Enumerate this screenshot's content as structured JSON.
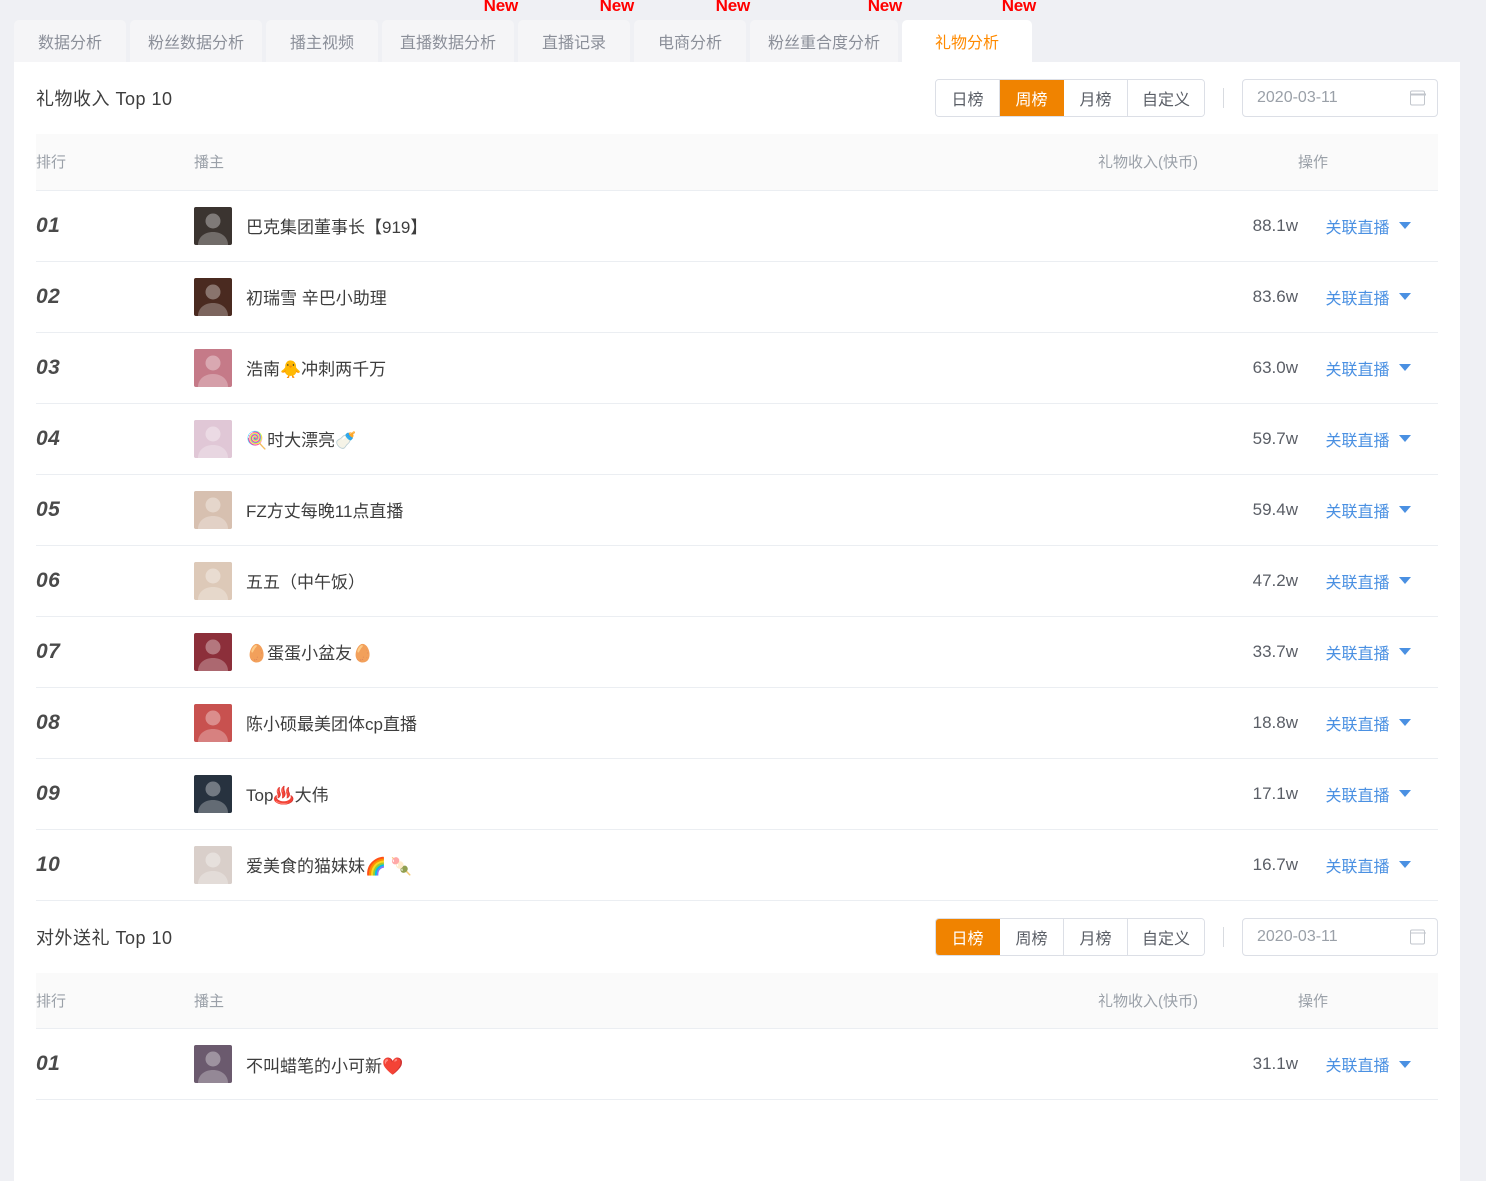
{
  "tabs": [
    {
      "label": "数据分析",
      "new": false,
      "active": false
    },
    {
      "label": "粉丝数据分析",
      "new": false,
      "active": false
    },
    {
      "label": "播主视频",
      "new": false,
      "active": false
    },
    {
      "label": "直播数据分析",
      "new": true,
      "active": false
    },
    {
      "label": "直播记录",
      "new": true,
      "active": false
    },
    {
      "label": "电商分析",
      "new": true,
      "active": false
    },
    {
      "label": "粉丝重合度分析",
      "new": true,
      "active": false
    },
    {
      "label": "礼物分析",
      "new": true,
      "active": true
    }
  ],
  "badge_text": "New",
  "colors": {
    "accent": "#f08300",
    "active_tab_text": "#ff8a00",
    "link": "#4a90e2",
    "badge": "#ff0000",
    "page_bg": "#eff0f4"
  },
  "columns": {
    "rank": "排行",
    "host": "播主",
    "value": "礼物收入(快币)",
    "action": "操作"
  },
  "action_label": "关联直播",
  "sections": [
    {
      "title": "礼物收入 Top 10",
      "range_buttons": [
        {
          "label": "日榜",
          "active": false
        },
        {
          "label": "周榜",
          "active": true
        },
        {
          "label": "月榜",
          "active": false
        },
        {
          "label": "自定义",
          "active": false
        }
      ],
      "date": "2020-03-11",
      "rows": [
        {
          "rank": "01",
          "name": "巴克集团董事长【919】",
          "value": "88.1w",
          "avatar": "#3b3430"
        },
        {
          "rank": "02",
          "name": "初瑞雪 辛巴小助理",
          "value": "83.6w",
          "avatar": "#4a2a20"
        },
        {
          "rank": "03",
          "name": "浩南🐥冲刺两千万",
          "value": "63.0w",
          "avatar": "#c57a88"
        },
        {
          "rank": "04",
          "name": "🍭时大漂亮🍼",
          "value": "59.7w",
          "avatar": "#e0c7d6"
        },
        {
          "rank": "05",
          "name": "FZ方丈每晚11点直播",
          "value": "59.4w",
          "avatar": "#d7c0b0"
        },
        {
          "rank": "06",
          "name": "五五（中午饭）",
          "value": "47.2w",
          "avatar": "#ddc9b8"
        },
        {
          "rank": "07",
          "name": "🥚蛋蛋小盆友🥚",
          "value": "33.7w",
          "avatar": "#8c2f3a"
        },
        {
          "rank": "08",
          "name": "陈小硕最美团体cp直播",
          "value": "18.8w",
          "avatar": "#c8514f"
        },
        {
          "rank": "09",
          "name": "Top♨️大伟",
          "value": "17.1w",
          "avatar": "#27323f"
        },
        {
          "rank": "10",
          "name": "爱美食的猫妹妹🌈 🍡",
          "value": "16.7w",
          "avatar": "#d9cfca"
        }
      ]
    },
    {
      "title": "对外送礼 Top 10",
      "range_buttons": [
        {
          "label": "日榜",
          "active": true
        },
        {
          "label": "周榜",
          "active": false
        },
        {
          "label": "月榜",
          "active": false
        },
        {
          "label": "自定义",
          "active": false
        }
      ],
      "date": "2020-03-11",
      "rows": [
        {
          "rank": "01",
          "name": "不叫蜡笔的小可新❤️",
          "value": "31.1w",
          "avatar": "#6b5a6e"
        }
      ]
    }
  ]
}
